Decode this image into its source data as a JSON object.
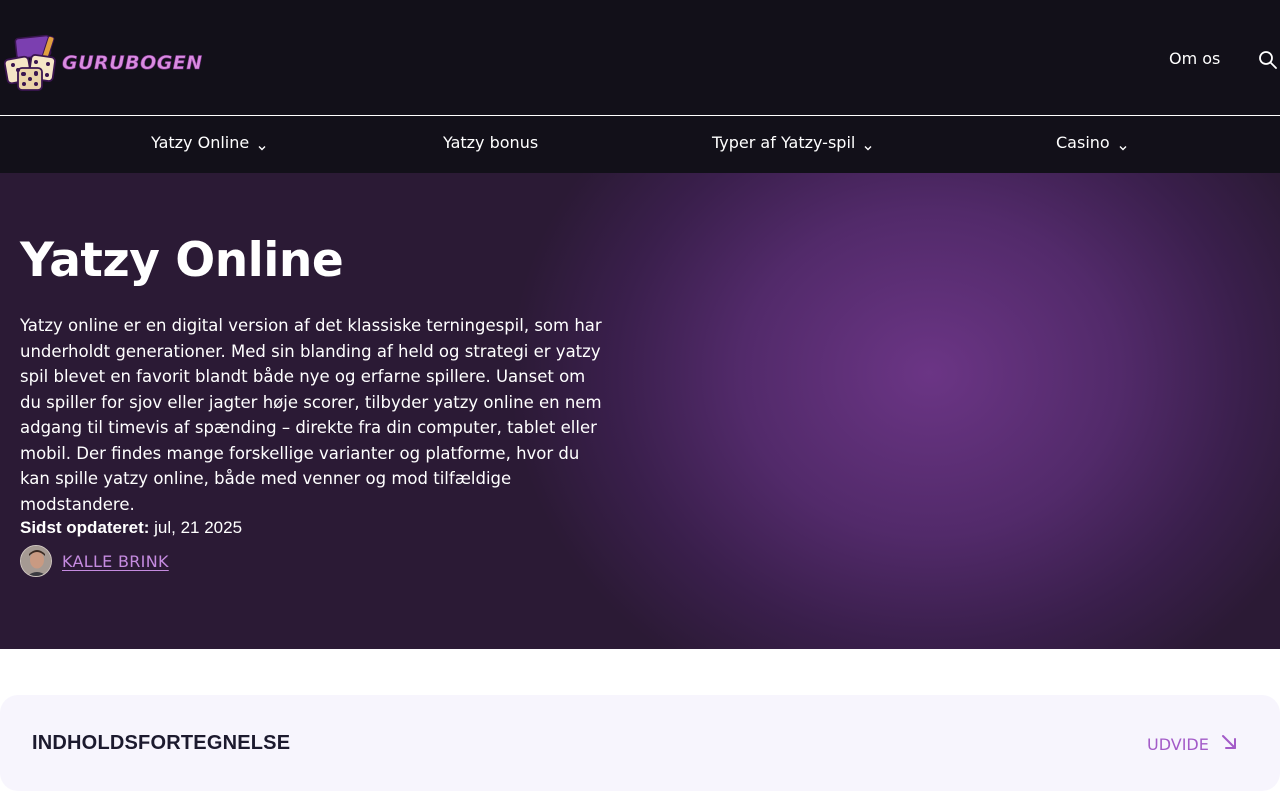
{
  "header": {
    "logo_text": "GURUBOGEN",
    "top_link": "Om os",
    "search_icon": "search-icon"
  },
  "mainnav": {
    "items": [
      {
        "label": "Yatzy Online",
        "has_dropdown": true
      },
      {
        "label": "Yatzy bonus",
        "has_dropdown": false
      },
      {
        "label": "Typer af Yatzy-spil",
        "has_dropdown": true
      },
      {
        "label": "Casino",
        "has_dropdown": true
      }
    ]
  },
  "hero": {
    "title": "Yatzy Online",
    "text": "Yatzy online er en digital version af det klassiske terningespil, som har underholdt generationer. Med sin blanding af held og strategi er yatzy spil blevet en favorit blandt både nye og erfarne spillere. Uanset om du spiller for sjov eller jagter høje scorer, tilbyder yatzy online en nem adgang til timevis af spænding – direkte fra din computer, tablet eller mobil. Der findes mange forskellige varianter og platforme, hvor du kan spille yatzy online, både med venner og mod tilfældige modstandere.",
    "updated_label": "Sidst opdateret:",
    "updated_value": "jul, 21 2025",
    "author": "KALLE BRINK"
  },
  "toc": {
    "title": "INDHOLDSFORTEGNELSE",
    "expand_label": "UDVIDE"
  },
  "colors": {
    "header_bg": "#121019",
    "hero_glow": "#6b3585",
    "accent": "#a35bc8",
    "toc_bg": "#f7f5fd"
  }
}
